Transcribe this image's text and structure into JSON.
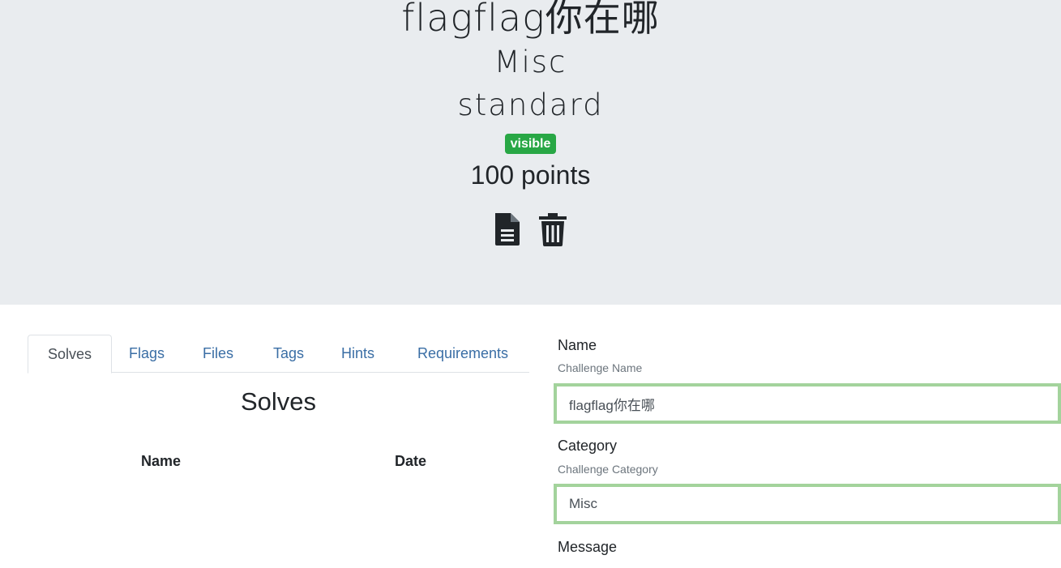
{
  "header": {
    "challenge_name": "flagflag你在哪",
    "category": "Misc",
    "type": "standard",
    "state_badge": "visible",
    "points": "100 points"
  },
  "tabs": [
    {
      "label": "Solves"
    },
    {
      "label": "Flags"
    },
    {
      "label": "Files"
    },
    {
      "label": "Tags"
    },
    {
      "label": "Hints"
    },
    {
      "label": "Requirements"
    }
  ],
  "solves": {
    "title": "Solves",
    "columns": [
      "Name",
      "Date"
    ]
  },
  "form": {
    "name_label": "Name",
    "name_help": "Challenge Name",
    "name_value": "flagflag你在哪",
    "category_label": "Category",
    "category_help": "Challenge Category",
    "category_value": "Misc",
    "message_label": "Message"
  },
  "colors": {
    "jumbotron_bg": "#e9ecef",
    "badge_success": "#28a745",
    "link": "#3a6ea5",
    "input_valid_border": "#a3d39c"
  }
}
